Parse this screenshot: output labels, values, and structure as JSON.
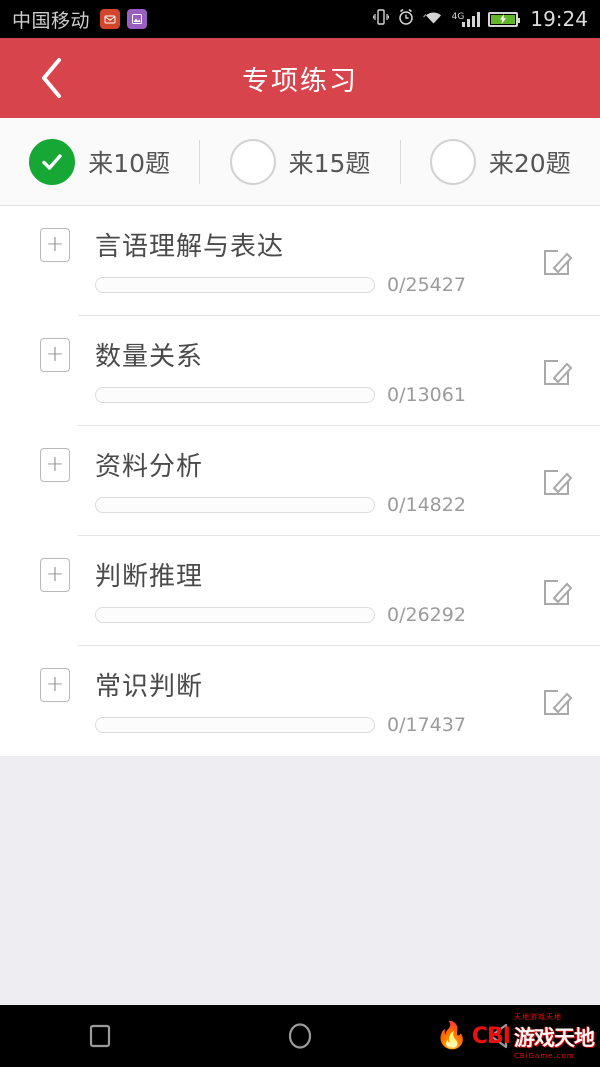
{
  "statusbar": {
    "carrier": "中国移动",
    "app_icons": [
      "mail-icon",
      "gallery-icon"
    ],
    "vibrate_icon": "vibrate-icon",
    "alarm_icon": "alarm-clock-icon",
    "wifi_icon": "wifi-icon",
    "network_type": "4G",
    "signal_icon": "signal-bars-icon",
    "battery_icon": "battery-charging-icon",
    "time": "19:24"
  },
  "header": {
    "back_icon": "back-chevron-icon",
    "title": "专项练习",
    "color": "#d8444c"
  },
  "selector": {
    "options": [
      {
        "label": "来10题",
        "selected": true
      },
      {
        "label": "来15题",
        "selected": false
      },
      {
        "label": "来20题",
        "selected": false
      }
    ],
    "accent_color": "#16a735"
  },
  "list": {
    "expand_icon": "plus-icon",
    "edit_icon": "pencil-edit-icon",
    "rows": [
      {
        "title": "言语理解与表达",
        "count": "0/25427",
        "progress": 0
      },
      {
        "title": "数量关系",
        "count": "0/13061",
        "progress": 0
      },
      {
        "title": "资料分析",
        "count": "0/14822",
        "progress": 0
      },
      {
        "title": "判断推理",
        "count": "0/26292",
        "progress": 0
      },
      {
        "title": "常识判断",
        "count": "0/17437",
        "progress": 0
      }
    ]
  },
  "navbar": {
    "recents_icon": "square-recents-icon",
    "home_icon": "circle-home-icon",
    "back_icon": "triangle-back-icon",
    "watermark": {
      "brand": "CBI",
      "name": "游戏天地",
      "top": "天地游戏天地",
      "site": "CBiGame.com"
    }
  }
}
